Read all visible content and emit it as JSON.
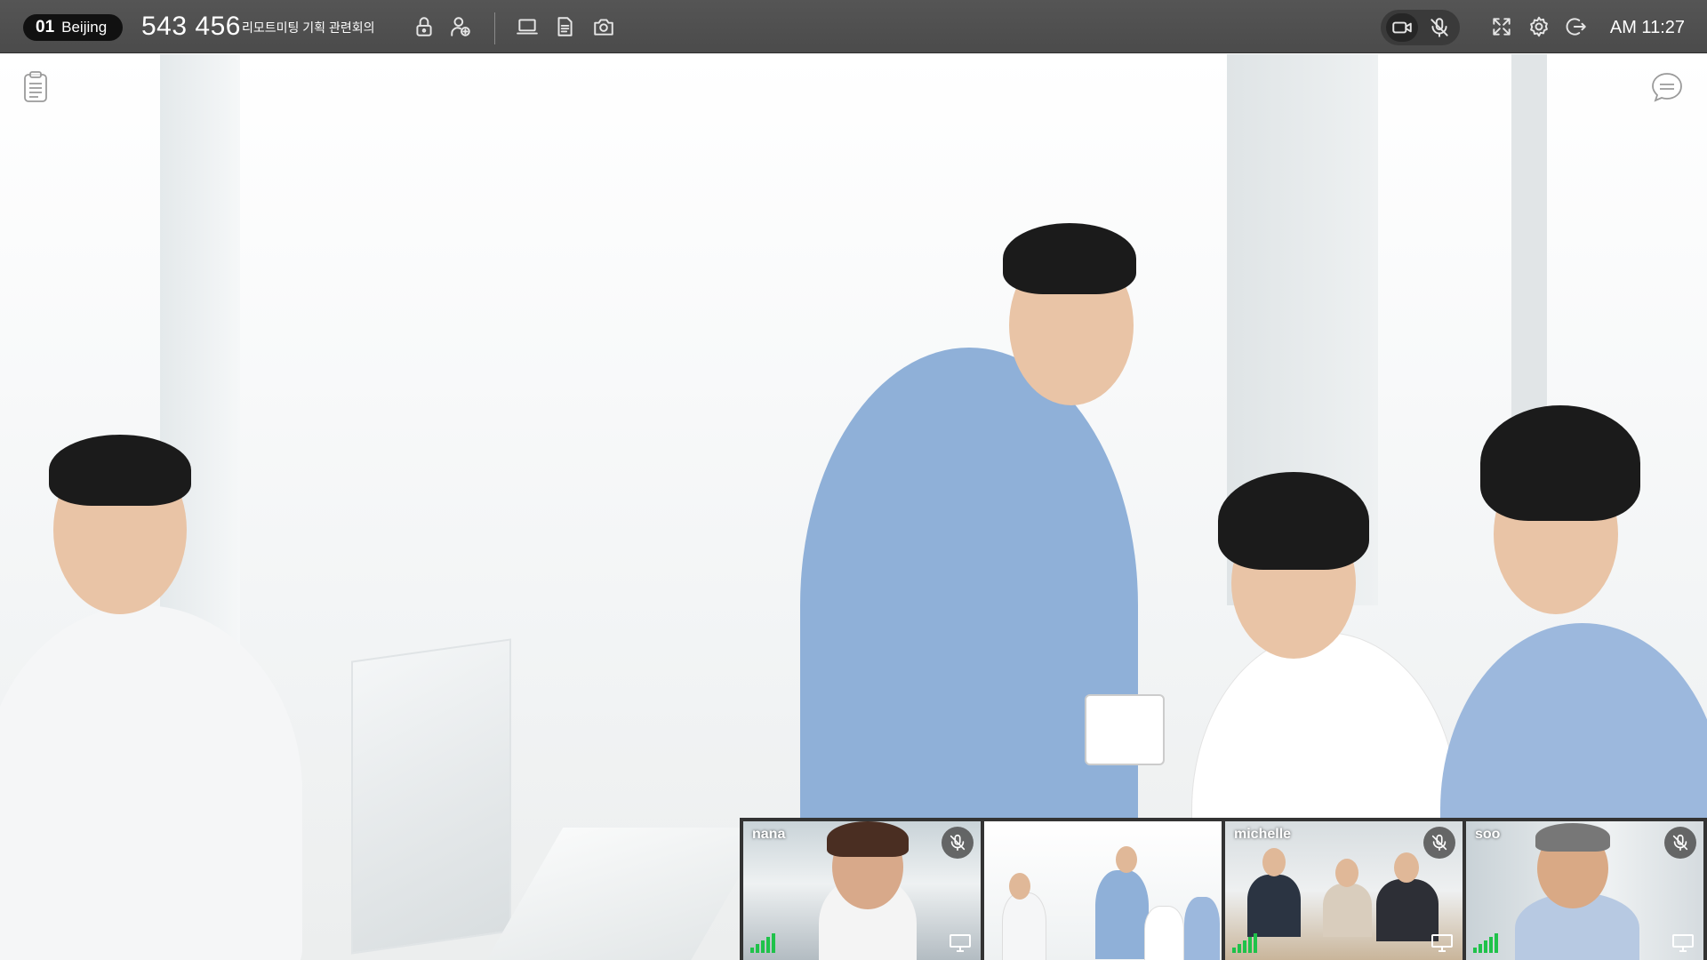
{
  "header": {
    "room_number": "01",
    "room_city": "Beijing",
    "meeting_id": "543 456",
    "meeting_title": "리모트미팅 기획 관련회의",
    "clock": "AM 11:27"
  },
  "toolbar_icons": [
    "lock-icon",
    "add-user-icon",
    "screen-share-icon",
    "document-icon",
    "snapshot-icon"
  ],
  "right_controls": [
    "camera-icon",
    "mic-muted-icon",
    "fullscreen-icon",
    "settings-icon",
    "exit-icon"
  ],
  "side_icons": [
    "notes-icon",
    "chat-icon"
  ],
  "participants": [
    {
      "name": "nana",
      "muted": true,
      "signal": 4,
      "screen_icon": true,
      "selected": false
    },
    {
      "name": "",
      "muted": false,
      "signal": 0,
      "screen_icon": false,
      "selected": true
    },
    {
      "name": "michelle",
      "muted": true,
      "signal": 4,
      "screen_icon": true,
      "selected": false
    },
    {
      "name": "soo",
      "muted": true,
      "signal": 4,
      "screen_icon": true,
      "selected": false
    }
  ],
  "colors": {
    "active_border": "#1fa34a",
    "signal": "#1fc24a",
    "topbar": "#4e4e4e"
  }
}
